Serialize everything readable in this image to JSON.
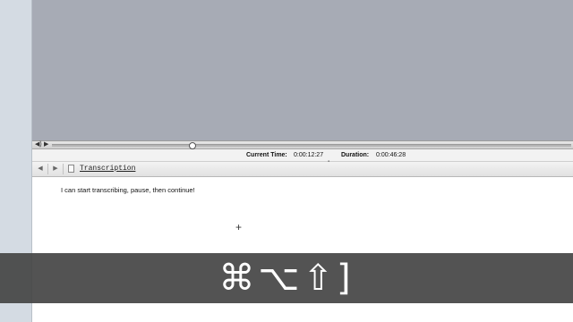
{
  "timebar": {
    "current_time_label": "Current Time:",
    "current_time_value": "0:00:12:27",
    "duration_label": "Duration:",
    "duration_value": "0:00:46:28"
  },
  "transport": {
    "volume_icon": "speaker-icon",
    "play_icon": "play-icon",
    "position_fraction": 0.27
  },
  "doc_toolbar": {
    "back_icon": "back-arrow-icon",
    "forward_icon": "forward-arrow-icon",
    "back_glyph": "◀",
    "forward_glyph": "▶",
    "document_title": "Transcription"
  },
  "editor": {
    "text": "I can start transcribing, pause, then continue!"
  },
  "shortcut_overlay": {
    "keys": "⌘⌥⇧]"
  },
  "colors": {
    "media_background": "#a7abb5",
    "sidebar": "#d4dbe3",
    "overlay": "#464646"
  }
}
